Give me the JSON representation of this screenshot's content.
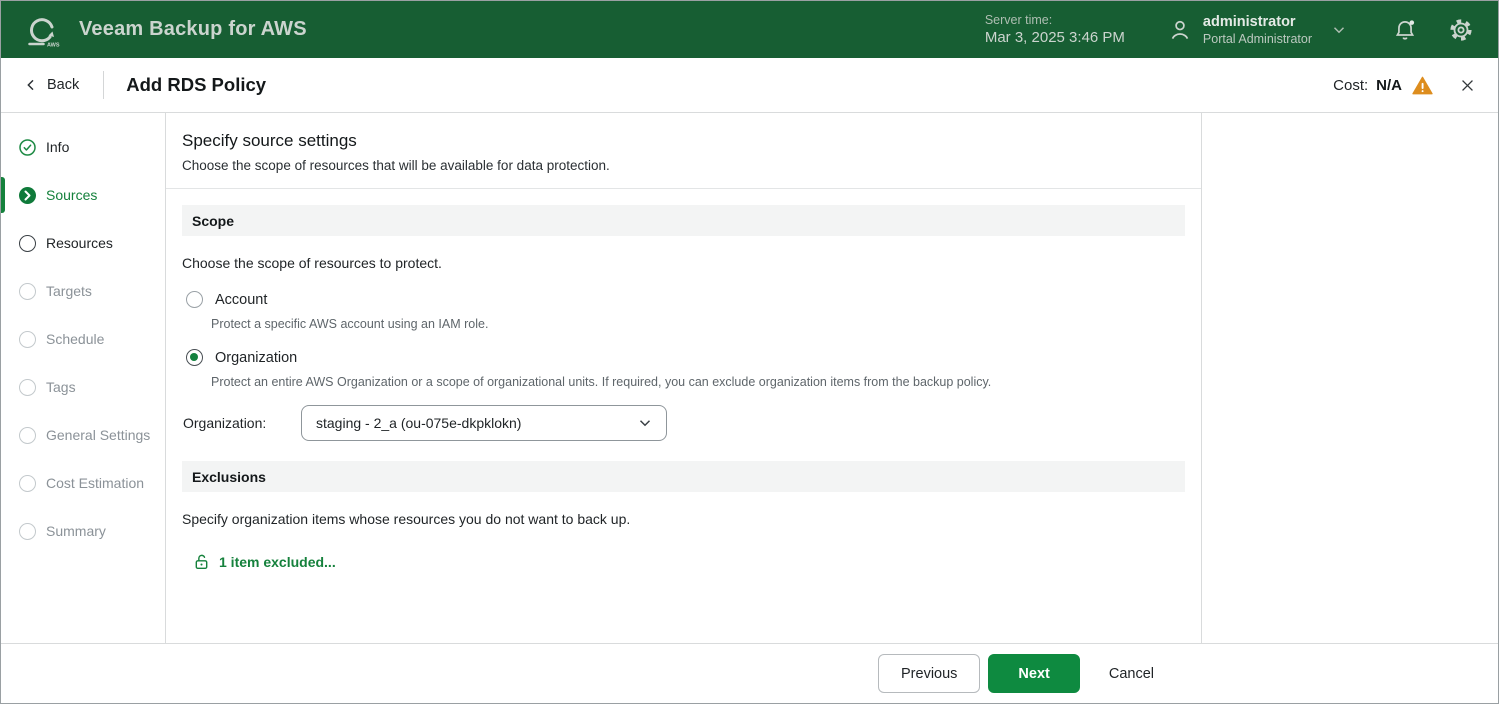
{
  "header": {
    "logo_sub": "AWS",
    "app_title": "Veeam Backup for AWS",
    "server_time_label": "Server time:",
    "server_time_value": "Mar 3, 2025 3:46 PM",
    "user_name": "administrator",
    "user_role": "Portal Administrator"
  },
  "toolbar": {
    "back_label": "Back",
    "page_title": "Add RDS Policy",
    "cost_label": "Cost:",
    "cost_value": "N/A"
  },
  "wizard_steps": [
    {
      "label": "Info",
      "state": "completed"
    },
    {
      "label": "Sources",
      "state": "current"
    },
    {
      "label": "Resources",
      "state": "active"
    },
    {
      "label": "Targets",
      "state": "pending"
    },
    {
      "label": "Schedule",
      "state": "pending"
    },
    {
      "label": "Tags",
      "state": "pending"
    },
    {
      "label": "General Settings",
      "state": "pending"
    },
    {
      "label": "Cost Estimation",
      "state": "pending"
    },
    {
      "label": "Summary",
      "state": "pending"
    }
  ],
  "main": {
    "heading": "Specify source settings",
    "subheading": "Choose the scope of resources that will be available for data protection.",
    "scope": {
      "title": "Scope",
      "instruction": "Choose the scope of resources to protect.",
      "options": [
        {
          "label": "Account",
          "description": "Protect a specific AWS account using an IAM role.",
          "selected": false
        },
        {
          "label": "Organization",
          "description": "Protect an entire AWS Organization or a scope of organizational units. If required, you can exclude organization items from the backup policy.",
          "selected": true
        }
      ],
      "organization_label": "Organization:",
      "organization_value": "staging - 2_a (ou-075e-dkpklokn)"
    },
    "exclusions": {
      "title": "Exclusions",
      "instruction": "Specify organization items whose resources you do not want to back up.",
      "link_label": "1 item excluded..."
    }
  },
  "footer": {
    "previous_label": "Previous",
    "next_label": "Next",
    "cancel_label": "Cancel"
  },
  "colors": {
    "header_green": "#175E33",
    "accent_green": "#15813C",
    "button_green": "#0E8A40",
    "warning_orange": "#DD8D1E"
  }
}
